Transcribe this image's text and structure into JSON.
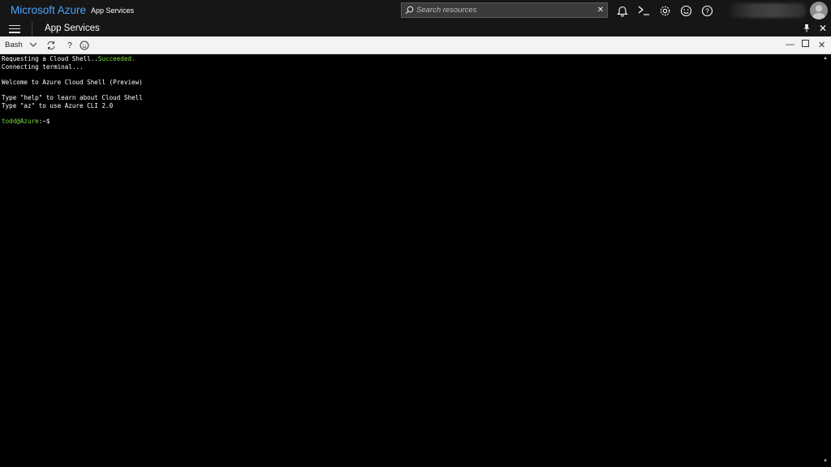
{
  "topbar": {
    "brand": "Microsoft Azure",
    "breadcrumb": "App Services",
    "search_placeholder": "Search resources",
    "search_clear": "✕"
  },
  "subbar": {
    "title": "App Services"
  },
  "shell_toolbar": {
    "shell_type": "Bash",
    "help": "?"
  },
  "terminal": {
    "lines": [
      {
        "text": "Requesting a Cloud Shell..",
        "accent": "Succeeded."
      },
      {
        "text": "Connecting terminal...",
        "accent": ""
      },
      {
        "text": "",
        "accent": ""
      },
      {
        "text": "Welcome to Azure Cloud Shell (Preview)",
        "accent": ""
      },
      {
        "text": "",
        "accent": ""
      },
      {
        "text": "Type \"help\" to learn about Cloud Shell",
        "accent": ""
      },
      {
        "text": "Type \"az\" to use Azure CLI 2.0",
        "accent": ""
      },
      {
        "text": "",
        "accent": ""
      }
    ],
    "prompt_user": "todd@Azure",
    "prompt_suffix": ":~$"
  },
  "colors": {
    "brand_blue": "#4aa3ff",
    "terminal_green": "#7ddc3f",
    "topbar_bg": "#161616"
  },
  "icons": [
    "search-icon",
    "bell-icon",
    "cloud-shell-icon",
    "gear-icon",
    "smiley-icon",
    "help-icon",
    "pin-icon",
    "close-icon",
    "hamburger-icon",
    "restart-icon",
    "feedback-icon",
    "minimize-icon",
    "maximize-icon"
  ]
}
